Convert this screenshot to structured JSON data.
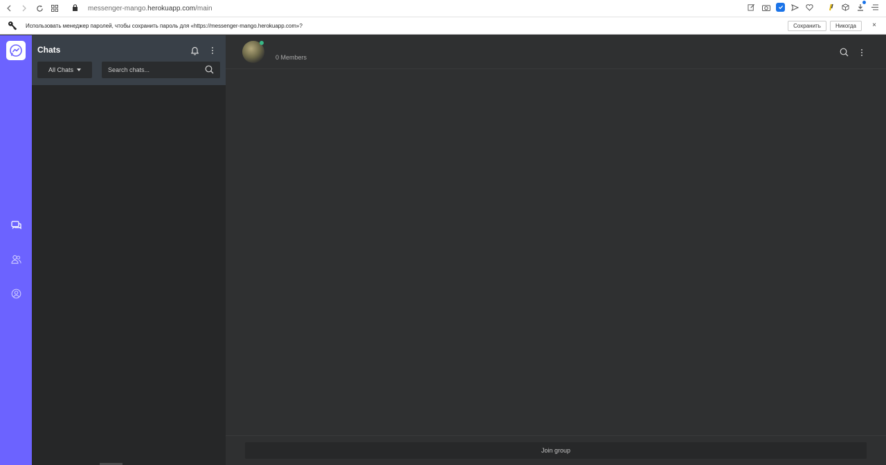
{
  "browser": {
    "url_prefix": "messenger-mango.",
    "url_host": "herokuapp.com",
    "url_path": "/main",
    "icons": [
      "back-icon",
      "forward-icon",
      "reload-icon",
      "tabs-grid-icon",
      "lock-icon",
      "edit-icon",
      "camera-icon",
      "shield-icon",
      "send-icon",
      "heart-icon",
      "extension-icon",
      "box-icon",
      "download-icon",
      "menu-icon"
    ]
  },
  "password_bar": {
    "message": "Использовать менеджер паролей, чтобы сохранить пароль для «https://messenger-mango.herokuapp.com»?",
    "save_label": "Сохранить",
    "never_label": "Никогда",
    "close_glyph": "×"
  },
  "sidebar": {
    "title": "Chats",
    "filter_label": "All Chats",
    "search_placeholder": "Search chats..."
  },
  "rail": {
    "accent_color": "#6c63ff",
    "icons": [
      "messenger-logo-icon",
      "chats-icon",
      "contacts-icon",
      "profile-icon"
    ]
  },
  "chat": {
    "members_label": "0 Members",
    "join_label": "Join group"
  }
}
